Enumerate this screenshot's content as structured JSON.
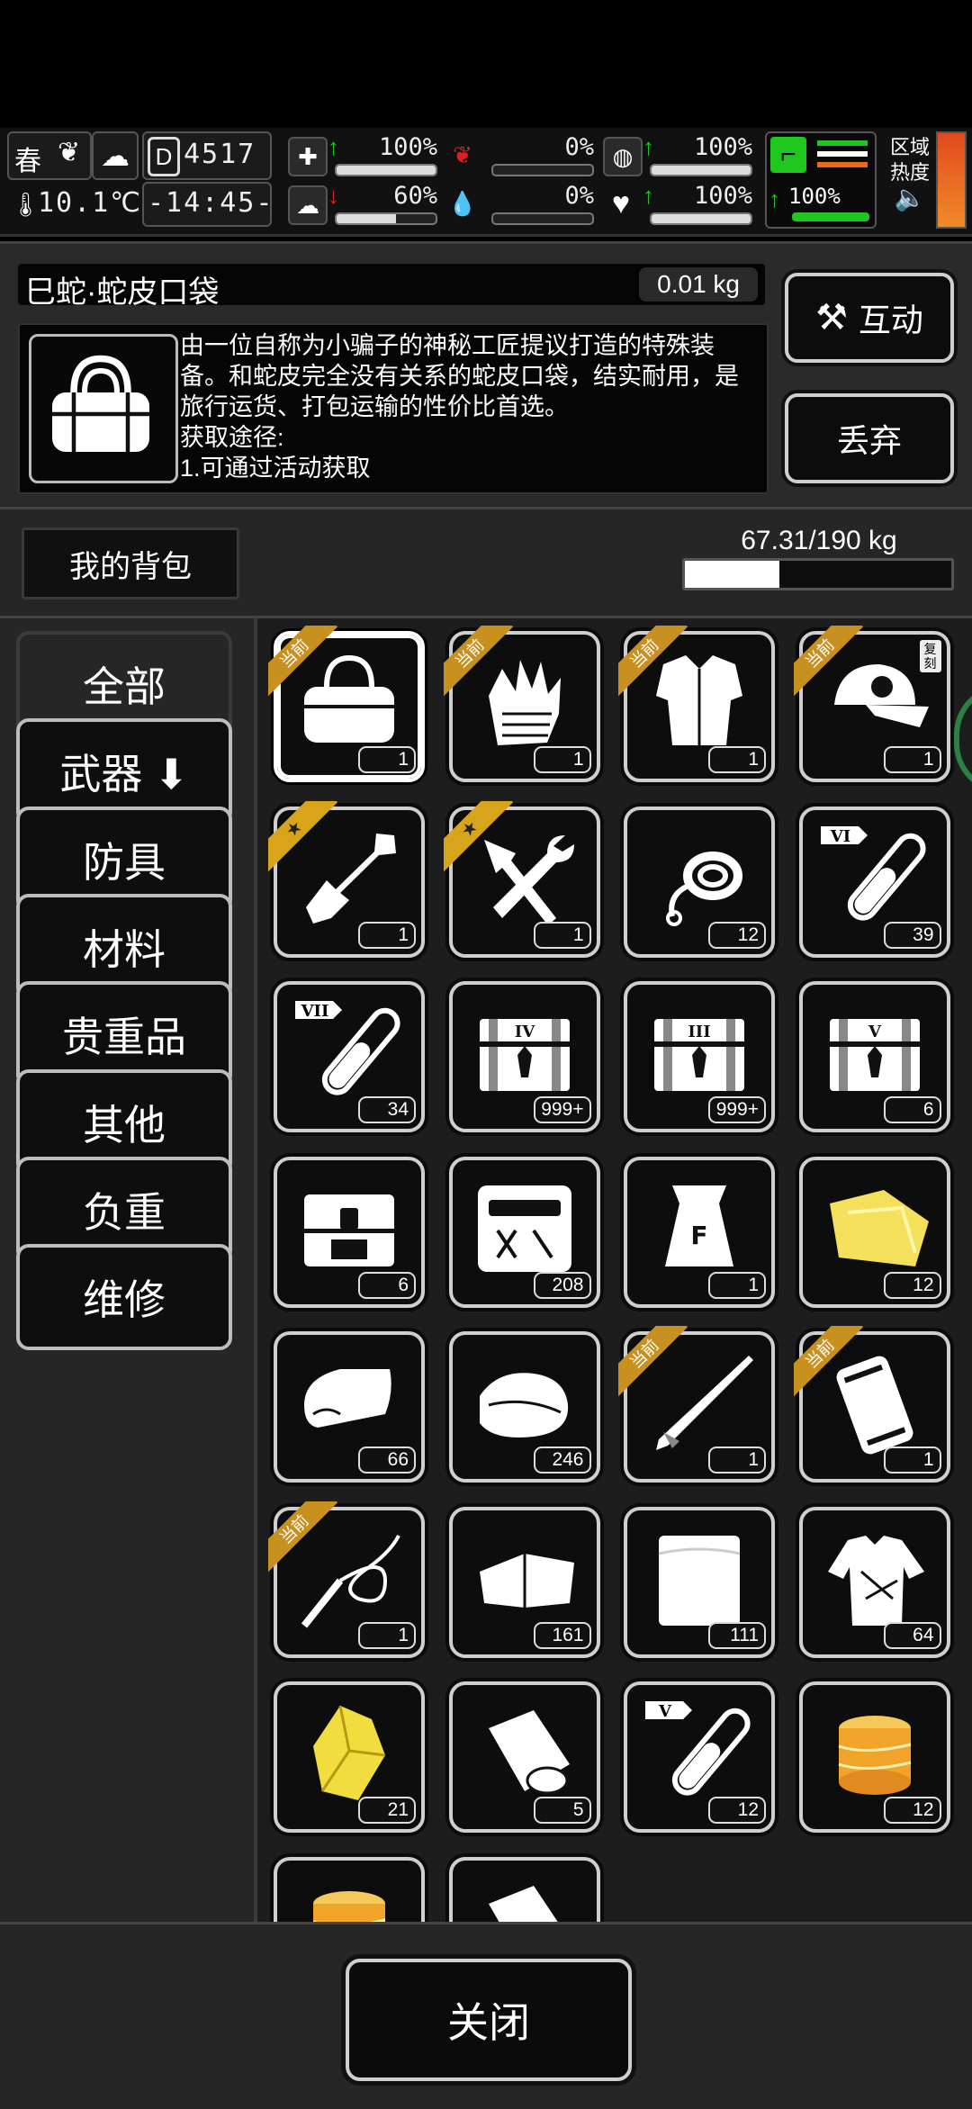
{
  "status": {
    "season": "春",
    "temperature": "10.1℃",
    "day": "4517",
    "time": "-14:45-",
    "stats": [
      {
        "name": "health",
        "pct": "100%",
        "fill": 1.0,
        "trend": "up"
      },
      {
        "name": "sanity",
        "pct": "60%",
        "fill": 0.6,
        "trend": "down"
      },
      {
        "name": "hunger",
        "pct": "0%",
        "fill": 0.0,
        "trend": "none"
      },
      {
        "name": "blood",
        "pct": "0%",
        "fill": 0.0,
        "trend": "none"
      },
      {
        "name": "stamina",
        "pct": "100%",
        "fill": 1.0,
        "trend": "up"
      },
      {
        "name": "mood",
        "pct": "100%",
        "fill": 1.0,
        "trend": "up"
      },
      {
        "name": "leg",
        "pct": "100%",
        "fill": 1.0,
        "trend": "up"
      }
    ],
    "region_label_1": "区域",
    "region_label_2": "热度",
    "speaker_icon": "speaker-icon"
  },
  "item": {
    "name": "巳蛇·蛇皮口袋",
    "weight": "0.01 kg",
    "description": "由一位自称为小骗子的神秘工匠提议打造的特殊装备。和蛇皮完全没有关系的蛇皮口袋，结实耐用，是旅行运货、打包运输的性价比首选。\n获取途径:\n1.可通过活动获取",
    "interact_label": "互动",
    "discard_label": "丢弃"
  },
  "pack": {
    "tab_label": "我的背包",
    "capacity": "67.31/190 kg",
    "capacity_fraction": 0.354
  },
  "categories": [
    {
      "label": "全部",
      "active": true
    },
    {
      "label": "武器 ⬇",
      "active": false
    },
    {
      "label": "防具",
      "active": false
    },
    {
      "label": "材料",
      "active": false
    },
    {
      "label": "贵重品",
      "active": false
    },
    {
      "label": "其他",
      "active": false
    },
    {
      "label": "负重",
      "active": false
    },
    {
      "label": "维修",
      "active": false
    }
  ],
  "current_tag": "当前",
  "copy_tag": "复刻",
  "items": [
    {
      "icon": "bag-icon",
      "count": "1",
      "tag": "current",
      "selected": true
    },
    {
      "icon": "glove-icon",
      "count": "1",
      "tag": "current"
    },
    {
      "icon": "armor-icon",
      "count": "1",
      "tag": "current"
    },
    {
      "icon": "cap-icon",
      "count": "1",
      "tag": "current",
      "copy": true
    },
    {
      "icon": "shovel-icon",
      "count": "1",
      "tag": "star"
    },
    {
      "icon": "tools-icon",
      "count": "1",
      "tag": "star"
    },
    {
      "icon": "rope-icon",
      "count": "12"
    },
    {
      "icon": "tube-icon",
      "count": "39",
      "roman": "VI"
    },
    {
      "icon": "tube-icon",
      "count": "34",
      "roman": "VII"
    },
    {
      "icon": "crate-icon",
      "count": "999+",
      "roman": "IV"
    },
    {
      "icon": "crate-icon",
      "count": "999+",
      "roman": "III"
    },
    {
      "icon": "crate-icon",
      "count": "6",
      "roman": "V"
    },
    {
      "icon": "chest-icon",
      "count": "6"
    },
    {
      "icon": "toolkit-icon",
      "count": "208"
    },
    {
      "icon": "sack-icon",
      "count": "1"
    },
    {
      "icon": "cloth-yellow-icon",
      "count": "12"
    },
    {
      "icon": "towel-icon",
      "count": "66"
    },
    {
      "icon": "rags-icon",
      "count": "246"
    },
    {
      "icon": "rifle-icon",
      "count": "1",
      "tag": "current"
    },
    {
      "icon": "case-icon",
      "count": "1",
      "tag": "current"
    },
    {
      "icon": "whip-icon",
      "count": "1",
      "tag": "current"
    },
    {
      "icon": "fabric-icon",
      "count": "161"
    },
    {
      "icon": "sheet-icon",
      "count": "111"
    },
    {
      "icon": "shirt-icon",
      "count": "64"
    },
    {
      "icon": "crystal-icon",
      "count": "21"
    },
    {
      "icon": "paper-roll-icon",
      "count": "5"
    },
    {
      "icon": "tube-icon",
      "count": "12",
      "roman": "V"
    },
    {
      "icon": "spool-icon",
      "count": "12"
    },
    {
      "icon": "spool-icon",
      "count": ""
    },
    {
      "icon": "paper-roll-icon",
      "count": ""
    }
  ],
  "close_label": "关闭"
}
